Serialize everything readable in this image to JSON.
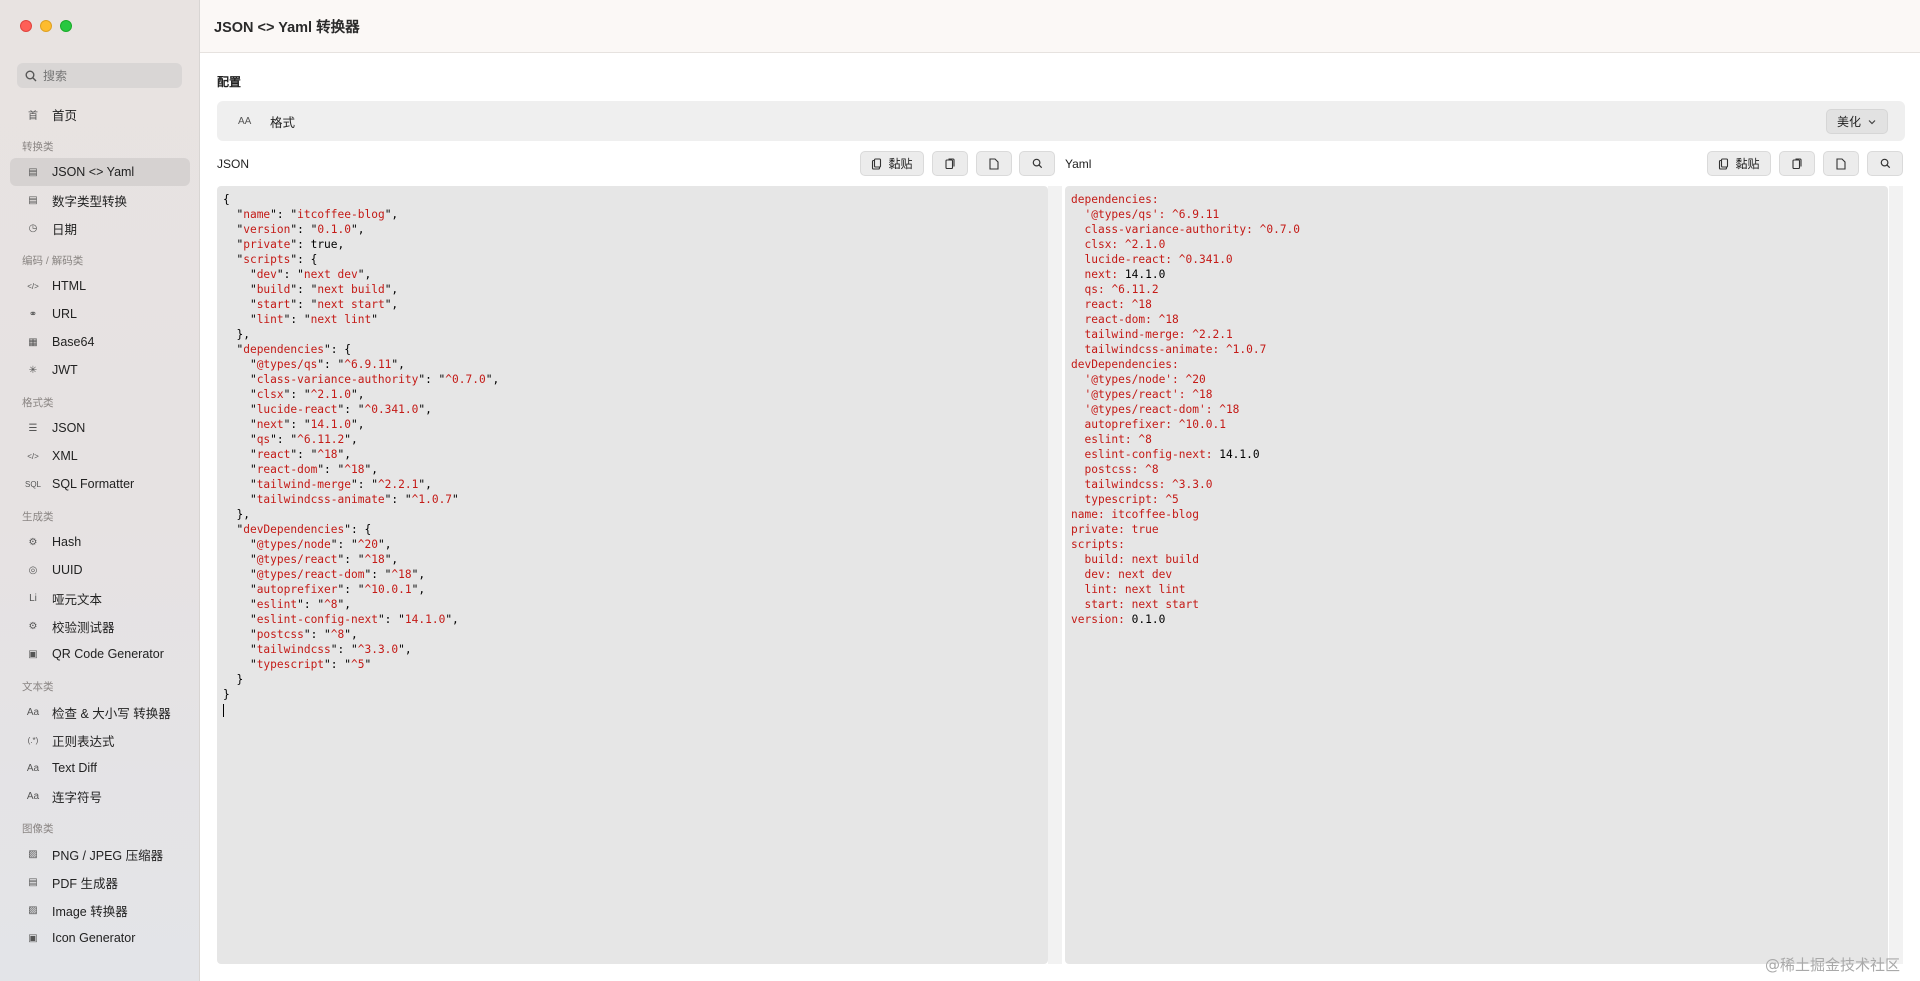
{
  "window": {
    "title": "JSON <> Yaml 转换器"
  },
  "sidebar": {
    "search_placeholder": "搜索",
    "home": "首页",
    "sections": [
      {
        "title": "转换类",
        "items": [
          "JSON <> Yaml",
          "数字类型转换",
          "日期"
        ]
      },
      {
        "title": "编码 / 解码类",
        "items": [
          "HTML",
          "URL",
          "Base64",
          "JWT"
        ]
      },
      {
        "title": "格式类",
        "items": [
          "JSON",
          "XML",
          "SQL Formatter"
        ]
      },
      {
        "title": "生成类",
        "items": [
          "Hash",
          "UUID",
          "哑元文本",
          "校验测试器",
          "QR Code Generator"
        ]
      },
      {
        "title": "文本类",
        "items": [
          "检查 & 大小写 转换器",
          "正则表达式",
          "Text Diff",
          "连字符号"
        ]
      },
      {
        "title": "图像类",
        "items": [
          "PNG / JPEG 压缩器",
          "PDF 生成器",
          "Image 转换器",
          "Icon Generator"
        ]
      }
    ],
    "item_icons": {
      "home": "首",
      "JSON <> Yaml": "▤",
      "数字类型转换": "▤",
      "日期": "◷",
      "HTML": "</>",
      "URL": "⚭",
      "Base64": "▦",
      "JWT": "✳",
      "JSON": "☰",
      "XML": "</>",
      "SQL Formatter": "SQL",
      "Hash": "⚙",
      "UUID": "◎",
      "哑元文本": "Li",
      "校验测试器": "⚙",
      "QR Code Generator": "▣",
      "检查 & 大小写 转换器": "Aa",
      "正则表达式": "(.*)",
      "Text Diff": "Aa",
      "连字符号": "Aa",
      "PNG / JPEG 压缩器": "▨",
      "PDF 生成器": "▤",
      "Image 转换器": "▨",
      "Icon Generator": "▣"
    },
    "active": "JSON <> Yaml"
  },
  "config": {
    "label": "配置",
    "aa_icon": "AA",
    "format_label": "格式",
    "format_value": "美化"
  },
  "json_pane": {
    "title": "JSON",
    "paste_label": "黏贴"
  },
  "yaml_pane": {
    "title": "Yaml",
    "paste_label": "黏贴"
  },
  "json_text": "{\n  \"name\": \"itcoffee-blog\",\n  \"version\": \"0.1.0\",\n  \"private\": true,\n  \"scripts\": {\n    \"dev\": \"next dev\",\n    \"build\": \"next build\",\n    \"start\": \"next start\",\n    \"lint\": \"next lint\"\n  },\n  \"dependencies\": {\n    \"@types/qs\": \"^6.9.11\",\n    \"class-variance-authority\": \"^0.7.0\",\n    \"clsx\": \"^2.1.0\",\n    \"lucide-react\": \"^0.341.0\",\n    \"next\": \"14.1.0\",\n    \"qs\": \"^6.11.2\",\n    \"react\": \"^18\",\n    \"react-dom\": \"^18\",\n    \"tailwind-merge\": \"^2.2.1\",\n    \"tailwindcss-animate\": \"^1.0.7\"\n  },\n  \"devDependencies\": {\n    \"@types/node\": \"^20\",\n    \"@types/react\": \"^18\",\n    \"@types/react-dom\": \"^18\",\n    \"autoprefixer\": \"^10.0.1\",\n    \"eslint\": \"^8\",\n    \"eslint-config-next\": \"14.1.0\",\n    \"postcss\": \"^8\",\n    \"tailwindcss\": \"^3.3.0\",\n    \"typescript\": \"^5\"\n  }\n}",
  "yaml_text": "dependencies:\n  '@types/qs': ^6.9.11\n  class-variance-authority: ^0.7.0\n  clsx: ^2.1.0\n  lucide-react: ^0.341.0\n  next: 14.1.0\n  qs: ^6.11.2\n  react: ^18\n  react-dom: ^18\n  tailwind-merge: ^2.2.1\n  tailwindcss-animate: ^1.0.7\ndevDependencies:\n  '@types/node': ^20\n  '@types/react': ^18\n  '@types/react-dom': ^18\n  autoprefixer: ^10.0.1\n  eslint: ^8\n  eslint-config-next: 14.1.0\n  postcss: ^8\n  tailwindcss: ^3.3.0\n  typescript: ^5\nname: itcoffee-blog\nprivate: true\nscripts:\n  build: next build\n  dev: next dev\n  lint: next lint\n  start: next start\nversion: 0.1.0",
  "watermark": "@稀土掘金技术社区",
  "colors": {
    "key": "#c41a16",
    "active_bg": "#d6d2d1",
    "editor_bg": "#e6e6e6"
  }
}
